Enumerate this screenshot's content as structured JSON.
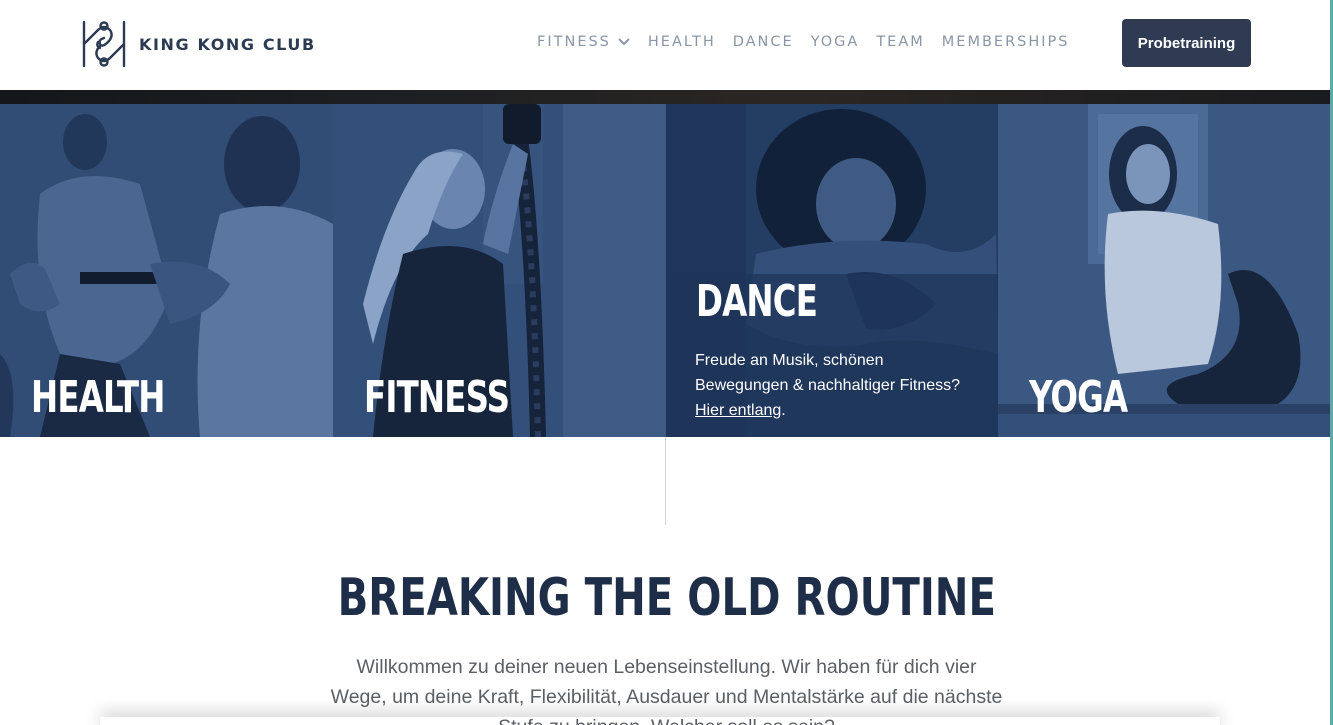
{
  "brand": {
    "name": "KING KONG CLUB",
    "colors": {
      "navy": "#2e3b53",
      "nav_text": "#8a96a6",
      "tile_overlay": "#2c4468",
      "headline": "#1f2e48"
    }
  },
  "nav": {
    "items": [
      {
        "label": "FITNESS",
        "has_dropdown": true,
        "icon": "chevron-down-icon"
      },
      {
        "label": "HEALTH"
      },
      {
        "label": "DANCE"
      },
      {
        "label": "YOGA"
      },
      {
        "label": "TEAM"
      },
      {
        "label": "MEMBERSHIPS"
      }
    ],
    "cta_label": "Probetraining"
  },
  "tiles": [
    {
      "title": "HEALTH"
    },
    {
      "title": "FITNESS"
    },
    {
      "title": "DANCE",
      "desc_line1": "Freude an Musik, schönen",
      "desc_line2": "Bewegungen & nachhaltiger Fitness?",
      "link_text": "Hier entlang",
      "link_suffix": "."
    },
    {
      "title": "YOGA"
    }
  ],
  "main": {
    "headline": "BREAKING THE OLD ROUTINE",
    "intro_line1": "Willkommen zu deiner neuen Lebenseinstellung. Wir haben für dich vier",
    "intro_line2": "Wege, um deine Kraft, Flexibilität, Ausdauer und Mentalstärke auf die nächste",
    "intro_line3": "Stufe zu bringen. Welcher soll es sein?"
  }
}
